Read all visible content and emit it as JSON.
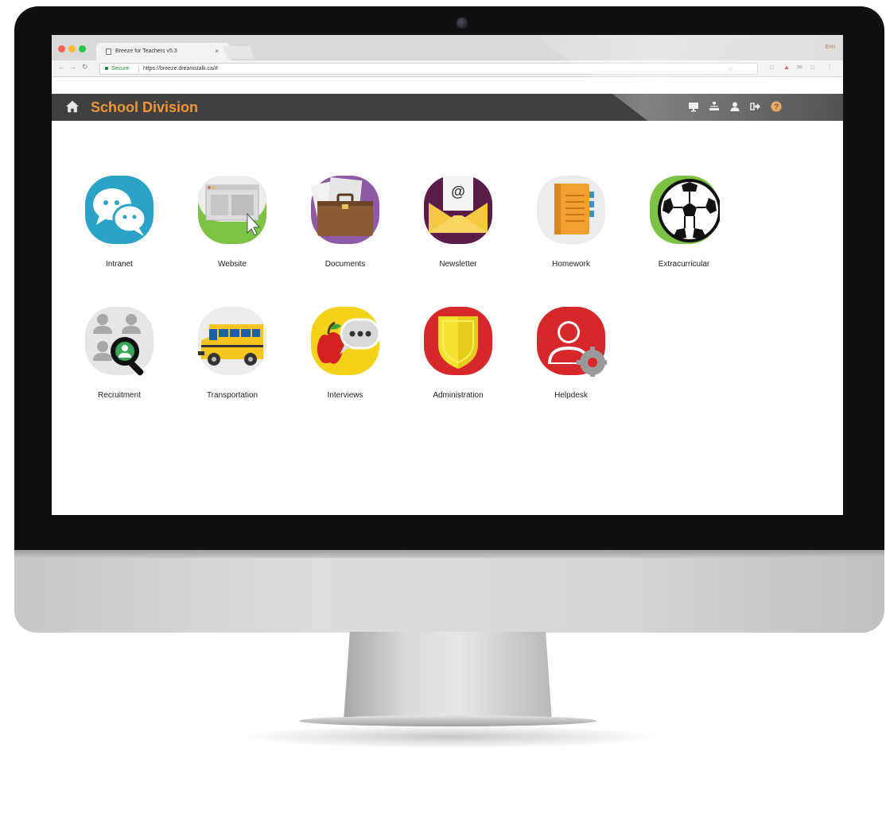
{
  "browser": {
    "tab_title": "Breeze for Teachers v5.3",
    "tab_close": "×",
    "profile_name": "Erin",
    "secure_label": "Secure",
    "url": "https://breeze.dreamstalk.ca/#"
  },
  "app": {
    "title": "School Division",
    "accent_color": "#f0963a",
    "header_color": "#404040",
    "header_icons": [
      "monitor-icon",
      "sitemap-icon",
      "user-icon",
      "sign-out-icon",
      "help-icon"
    ]
  },
  "apps": [
    {
      "label": "Intranet",
      "icon": "chat-bubbles-icon"
    },
    {
      "label": "Website",
      "icon": "browser-window-icon"
    },
    {
      "label": "Documents",
      "icon": "briefcase-icon"
    },
    {
      "label": "Newsletter",
      "icon": "envelope-icon"
    },
    {
      "label": "Homework",
      "icon": "notebook-icon"
    },
    {
      "label": "Extracurricular",
      "icon": "soccer-ball-icon"
    },
    {
      "label": "Recruitment",
      "icon": "magnifier-people-icon"
    },
    {
      "label": "Transportation",
      "icon": "school-bus-icon"
    },
    {
      "label": "Interviews",
      "icon": "apple-speech-icon"
    },
    {
      "label": "Administration",
      "icon": "shield-icon"
    },
    {
      "label": "Helpdesk",
      "icon": "user-gear-icon"
    }
  ]
}
